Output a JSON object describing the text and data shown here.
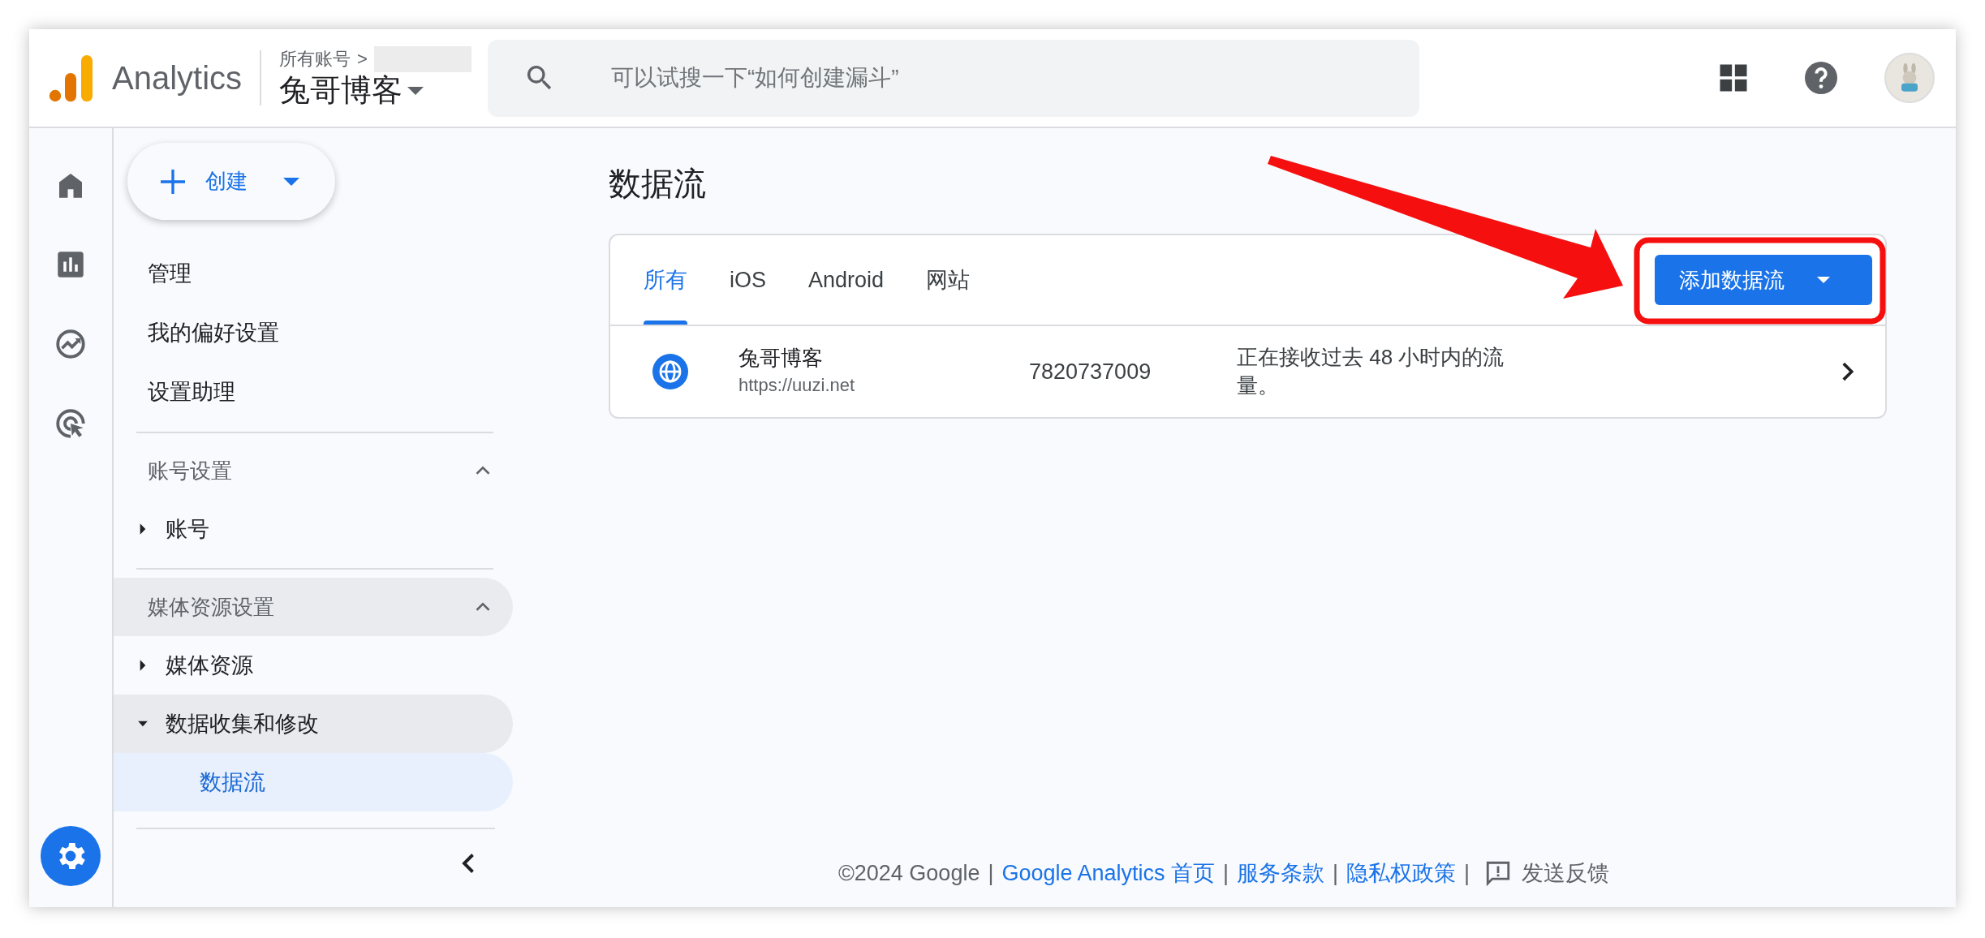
{
  "header": {
    "product": "Analytics",
    "breadcrumb": "所有账号",
    "breadcrumb_sep": ">",
    "account": "兔哥博客",
    "search_placeholder": "可以试搜一下“如何创建漏斗”"
  },
  "rail": [
    {
      "kind": "home",
      "selected": false
    },
    {
      "kind": "reports",
      "selected": false
    },
    {
      "kind": "explore",
      "selected": false
    },
    {
      "kind": "advertising",
      "selected": false
    },
    {
      "kind": "admin",
      "selected": true
    }
  ],
  "create_button": "创建",
  "menu": [
    {
      "label": "管理"
    },
    {
      "label": "我的偏好设置"
    },
    {
      "label": "设置助理"
    }
  ],
  "sections": [
    {
      "title": "账号设置",
      "expanded": true,
      "highlighted": false,
      "items": [
        {
          "label": "账号",
          "expanded": false,
          "highlighted": false
        }
      ]
    },
    {
      "title": "媒体资源设置",
      "expanded": true,
      "highlighted": true,
      "items": [
        {
          "label": "媒体资源",
          "expanded": false,
          "highlighted": false
        },
        {
          "label": "数据收集和修改",
          "expanded": true,
          "highlighted": true,
          "children": [
            {
              "label": "数据流",
              "selected": true
            }
          ]
        }
      ]
    }
  ],
  "page_title": "数据流",
  "tabs": [
    {
      "label": "所有",
      "selected": true
    },
    {
      "label": "iOS",
      "selected": false
    },
    {
      "label": "Android",
      "selected": false
    },
    {
      "label": "网站",
      "selected": false
    }
  ],
  "add_button": "添加数据流",
  "streams": [
    {
      "name": "兔哥博客",
      "url": "https://uuzi.net",
      "id": "7820737009",
      "status": "正在接收过去 48 小时内的流量。"
    }
  ],
  "footer": [
    {
      "kind": "text",
      "text": "©2024 Google"
    },
    {
      "kind": "separator",
      "text": "|"
    },
    {
      "kind": "link",
      "text": "Google Analytics 首页"
    },
    {
      "kind": "separator",
      "text": "|"
    },
    {
      "kind": "link",
      "text": "服务条款"
    },
    {
      "kind": "separator",
      "text": "|"
    },
    {
      "kind": "link",
      "text": "隐私权政策"
    },
    {
      "kind": "separator",
      "text": "|"
    },
    {
      "kind": "feedback",
      "text": "发送反馈"
    }
  ]
}
